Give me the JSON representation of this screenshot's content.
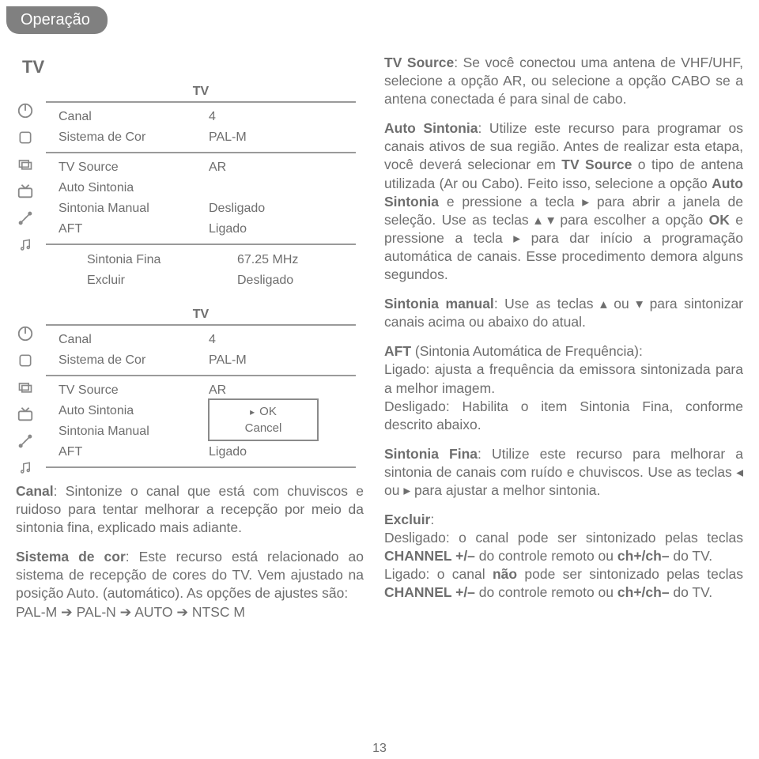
{
  "badge": "Operação",
  "section_label": "TV",
  "menu1": {
    "title": "TV",
    "rows": [
      {
        "label": "Canal",
        "value": "4"
      },
      {
        "label": "Sistema de Cor",
        "value": "PAL-M"
      },
      {
        "label": "TV Source",
        "value": "AR"
      },
      {
        "label": "Auto Sintonia",
        "value": ""
      },
      {
        "label": "Sintonia Manual",
        "value": "Desligado"
      },
      {
        "label": "AFT",
        "value": "Ligado"
      }
    ],
    "extra": [
      {
        "label": "Sintonia Fina",
        "value": "67.25 MHz"
      },
      {
        "label": "Excluir",
        "value": "Desligado"
      }
    ]
  },
  "menu2": {
    "title": "TV",
    "rows": [
      {
        "label": "Canal",
        "value": "4"
      },
      {
        "label": "Sistema de Cor",
        "value": "PAL-M"
      },
      {
        "label": "TV Source",
        "value": "AR"
      },
      {
        "label": "Auto Sintonia",
        "value": ""
      },
      {
        "label": "Sintonia Manual",
        "value": ""
      },
      {
        "label": "AFT",
        "value": "Ligado"
      }
    ],
    "popup": {
      "ok": "OK",
      "cancel": "Cancel"
    }
  },
  "left_para": {
    "canal_b": "Canal",
    "canal": ": Sintonize o canal que está com chuviscos e ruidoso para tentar melhorar a recepção por meio da sintonia fina, explicado mais adiante.",
    "sist_b": "Sistema de cor",
    "sist": ": Este recurso está relacionado ao sistema de recepção de cores do TV. Vem ajustado na posição Auto. (automático). As opções de ajustes são:",
    "seq": "PAL-M  ➔  PAL-N  ➔  AUTO  ➔  NTSC M"
  },
  "right_para": {
    "p1a": "TV Source",
    "p1b": ": Se você conectou uma antena de VHF/UHF, selecione a opção AR, ou selecione a opção CABO se a antena conectada é para sinal de cabo.",
    "p2a": "Auto Sintonia",
    "p2b": ": Utilize este recurso para programar os canais ativos de sua região. Antes de realizar esta etapa, você deverá selecionar em ",
    "p2c": "TV Source",
    "p2d": " o tipo de antena utilizada (Ar ou Cabo). Feito isso, selecione a opção ",
    "p2e": "Auto Sintonia",
    "p2f": " e pressione a tecla ▸ para abrir a janela de seleção. Use as teclas ▴ ▾ para escolher a opção ",
    "p2g": "OK",
    "p2h": " e pressione a tecla ▸ para dar início a programação automática de canais. Esse procedimento demora alguns segundos.",
    "p3a": "Sintonia manual",
    "p3b": ": Use as teclas ▴ ou ▾ para sintonizar canais acima ou abaixo do atual.",
    "p4a": "AFT",
    "p4b": " (Sintonia Automática de Frequência):",
    "p4c": "Ligado: ajusta a frequência da emissora sintonizada para a melhor imagem.",
    "p4d": "Desligado: Habilita o item Sintonia Fina, conforme descrito abaixo.",
    "p5a": "Sintonia Fina",
    "p5b": ": Utilize este recurso para melhorar a sintonia de canais com ruído e chuviscos. Use as teclas ◂ ou ▸  para ajustar a melhor sintonia.",
    "p6a": "Excluir",
    "p6b": ":",
    "p6c": "Desligado: o canal pode ser sintonizado pelas teclas ",
    "p6d": "CHANNEL +/–",
    "p6e": " do controle remoto ou ",
    "p6f": "ch+/ch–",
    "p6g": "  do  TV.",
    "p6h": "Ligado: o canal ",
    "p6i": "não",
    "p6j": " pode ser sintonizado pelas teclas ",
    "p6k": "CHANNEL +/–",
    "p6l": " do controle remoto ou ",
    "p6m": "ch+/ch–",
    "p6n": "  do TV."
  },
  "pagenum": "13"
}
